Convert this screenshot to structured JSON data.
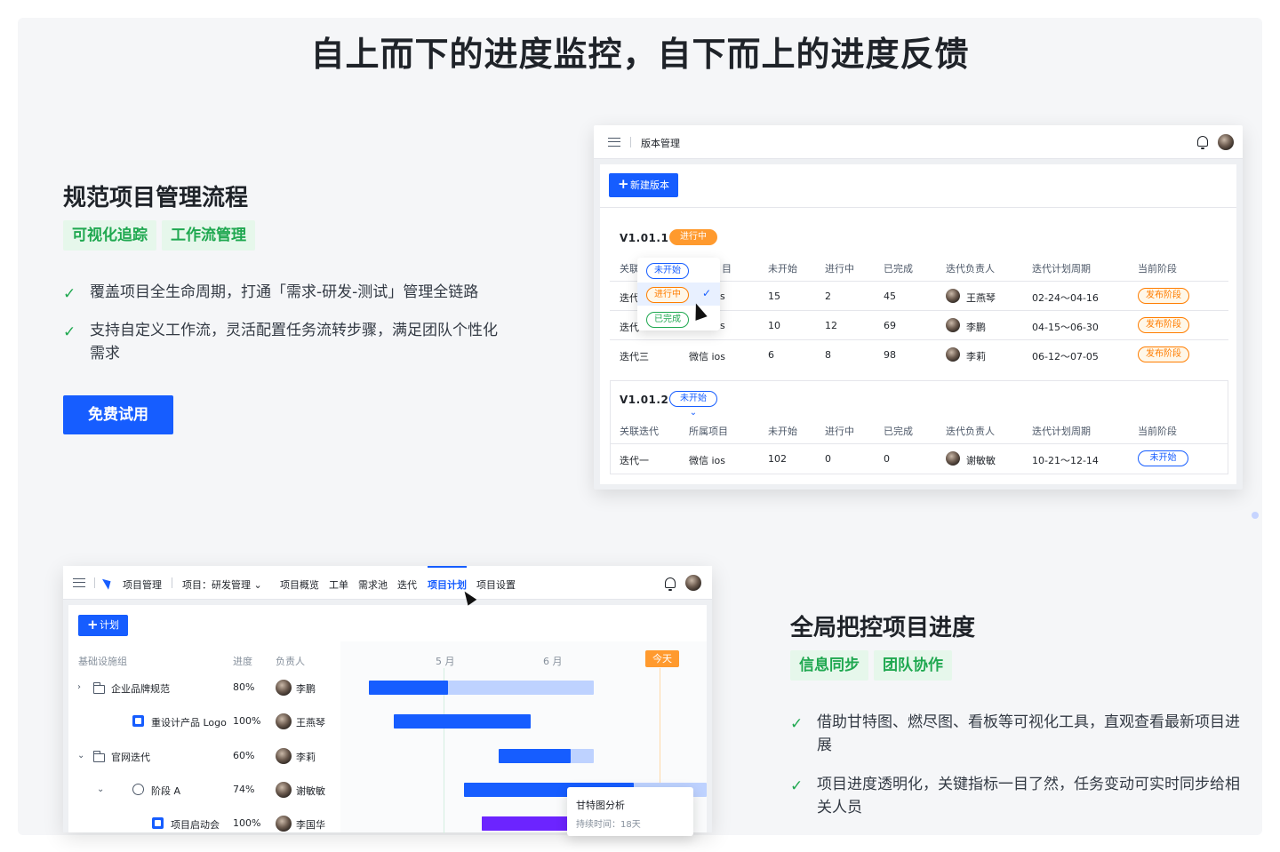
{
  "hero": {
    "title": "自上而下的进度监控，自下而上的进度反馈"
  },
  "section1": {
    "title": "规范项目管理流程",
    "tags": [
      "可视化追踪",
      "工作流管理"
    ],
    "features": [
      "覆盖项目全生命周期，打通「需求-研发-测试」管理全链路",
      "支持自定义工作流，灵活配置任务流转步骤，满足团队个性化需求"
    ],
    "cta_label": "免费试用"
  },
  "section2": {
    "title": "全局把控项目进度",
    "tags": [
      "信息同步",
      "团队协作"
    ],
    "features": [
      "借助甘特图、燃尽图、看板等可视化工具，直观查看最新项目进展",
      "项目进度透明化，关键指标一目了然，任务变动可实时同步给相关人员"
    ]
  },
  "version_card": {
    "header_title": "版本管理",
    "new_button": "新建版本",
    "columns": [
      "关联迭代",
      "所属项目",
      "未开始",
      "进行中",
      "已完成",
      "迭代负责人",
      "迭代计划周期",
      "当前阶段"
    ],
    "dropdown_options": [
      "未开始",
      "进行中",
      "已完成"
    ],
    "versions": [
      {
        "name": "V1.01.1",
        "status": "进行中",
        "rows": [
          {
            "iteration": "迭代",
            "project": "s",
            "not_started": "15",
            "in_progress": "2",
            "done": "45",
            "owner": "王燕琴",
            "period": "02-24〜04-16",
            "stage": "发布阶段"
          },
          {
            "iteration": "迭代",
            "project": "s",
            "not_started": "10",
            "in_progress": "12",
            "done": "69",
            "owner": "李鹏",
            "period": "04-15〜06-30",
            "stage": "发布阶段"
          },
          {
            "iteration": "迭代三",
            "project": "微信 ios",
            "not_started": "6",
            "in_progress": "8",
            "done": "98",
            "owner": "李莉",
            "period": "06-12〜07-05",
            "stage": "发布阶段"
          }
        ]
      },
      {
        "name": "V1.01.2",
        "status": "未开始",
        "rows": [
          {
            "iteration": "迭代一",
            "project": "微信 ios",
            "not_started": "102",
            "in_progress": "0",
            "done": "0",
            "owner": "谢敏敏",
            "period": "10-21〜12-14",
            "stage": "未开始"
          }
        ]
      }
    ],
    "header_partial": "关联",
    "header_partial2": "目"
  },
  "gantt_card": {
    "app_name": "项目管理",
    "project_selector": "项目：研发管理",
    "nav": [
      "项目概览",
      "工单",
      "需求池",
      "迭代",
      "项目计划",
      "项目设置"
    ],
    "active_nav": "项目计划",
    "plan_button": "计划",
    "columns": [
      "基础设施组",
      "进度",
      "负责人"
    ],
    "months": [
      "5 月",
      "6 月"
    ],
    "today_label": "今天",
    "rows": [
      {
        "name": "企业品牌规范",
        "progress": "80%",
        "owner": "李鹏",
        "level": 0,
        "icon": "folder-icon",
        "expand": "collapsed"
      },
      {
        "name": "重设计产品 Logo",
        "progress": "100%",
        "owner": "王燕琴",
        "level": 1,
        "icon": "doc-icon",
        "expand": ""
      },
      {
        "name": "官网迭代",
        "progress": "60%",
        "owner": "李莉",
        "level": 0,
        "icon": "folder-icon",
        "expand": "expanded"
      },
      {
        "name": "阶段 A",
        "progress": "74%",
        "owner": "谢敏敏",
        "level": 1,
        "icon": "stage-icon",
        "expand": "expanded"
      },
      {
        "name": "项目启动会",
        "progress": "100%",
        "owner": "李国华",
        "level": 2,
        "icon": "milestone-icon",
        "expand": ""
      }
    ],
    "bars": [
      {
        "start": 0.04,
        "end": 0.68,
        "done": 0.35,
        "color": "#165dff",
        "rest": "#bed2ff"
      },
      {
        "start": 0.11,
        "end": 0.5,
        "done": 1.0,
        "color": "#165dff",
        "rest": "#bed2ff"
      },
      {
        "start": 0.41,
        "end": 0.68,
        "done": 0.75,
        "color": "#165dff",
        "rest": "#bed2ff"
      },
      {
        "start": 0.31,
        "end": 1.0,
        "done": 0.7,
        "color": "#165dff",
        "rest": "#bed2ff"
      },
      {
        "start": 0.36,
        "end": 0.64,
        "done": 1.0,
        "color": "#6c24ff",
        "rest": "#6c24ff"
      }
    ],
    "tooltip": {
      "title": "甘特图分析",
      "duration": "持续时间：18天",
      "extra": "持续时..."
    },
    "colors": {
      "accent": "#165dff",
      "today": "#ff9a2e",
      "milestone": "#1fa850"
    }
  }
}
